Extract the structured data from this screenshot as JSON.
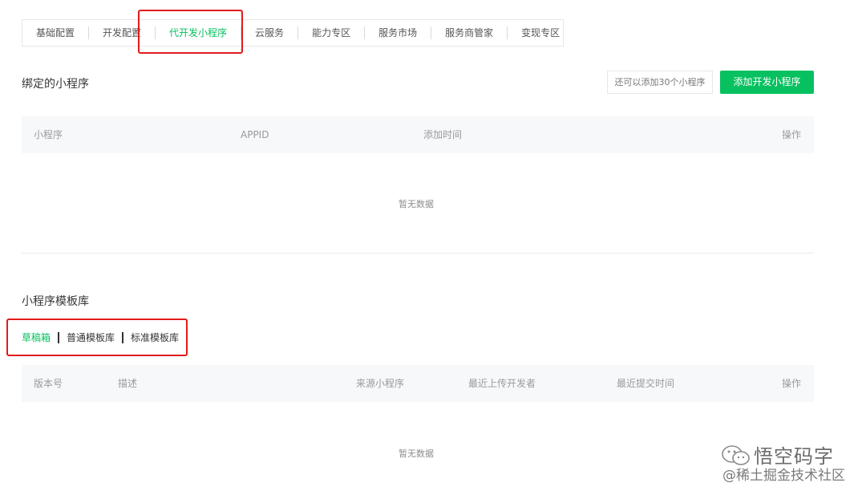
{
  "top_tabs": [
    {
      "label": "基础配置",
      "active": false
    },
    {
      "label": "开发配置",
      "active": false
    },
    {
      "label": "代开发小程序",
      "active": true
    },
    {
      "label": "云服务",
      "active": false
    },
    {
      "label": "能力专区",
      "active": false
    },
    {
      "label": "服务市场",
      "active": false
    },
    {
      "label": "服务商管家",
      "active": false
    },
    {
      "label": "变现专区",
      "active": false
    }
  ],
  "bound": {
    "title": "绑定的小程序",
    "hint": "还可以添加30个小程序",
    "add_button": "添加开发小程序",
    "columns": [
      "小程序",
      "APPID",
      "添加时间",
      "操作"
    ],
    "empty": "暂无数据"
  },
  "templates": {
    "title": "小程序模板库",
    "tabs": [
      {
        "label": "草稿箱",
        "active": true
      },
      {
        "label": "普通模板库",
        "active": false
      },
      {
        "label": "标准模板库",
        "active": false
      }
    ],
    "columns": [
      "版本号",
      "描述",
      "来源小程序",
      "最近上传开发者",
      "最近提交时间",
      "操作"
    ],
    "empty": "暂无数据"
  },
  "watermark": {
    "title": "悟空码字",
    "subtitle": "@稀土掘金技术社区",
    "logo_icon": "wechat-logo-icon"
  },
  "colors": {
    "accent": "#07c160",
    "highlight_box": "#e01b1b"
  }
}
